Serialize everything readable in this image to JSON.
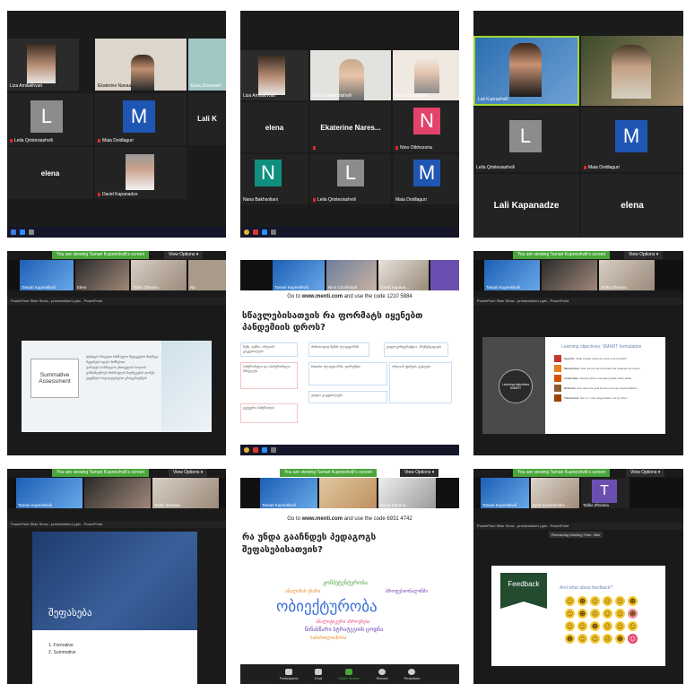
{
  "colors": {
    "blue_avatar": "#1f56b4",
    "teal_avatar": "#0f8f7e",
    "pink_avatar": "#e3426a",
    "grey_avatar": "#8c8c8c",
    "banner_green": "#4aa53a"
  },
  "screens": {
    "s1": {
      "tiles": [
        {
          "name": "Liza Amilakhvari"
        },
        {
          "name": "Ekaterine Nanaa..."
        },
        {
          "name": "Eliza Zhvaniani"
        },
        {
          "name": "Leila Qristesiashvili",
          "avatar": "L"
        },
        {
          "name": "Maia Doidlaguri",
          "avatar": "M"
        },
        {
          "name": "Lali K"
        },
        {
          "name": "elena"
        },
        {
          "name": "David Kapanadze"
        }
      ]
    },
    "s2": {
      "tiles": [
        {
          "name": "Liza Amilakhvari"
        },
        {
          "name": "Bela Goderdzishvili"
        },
        {
          "name": "Nino Chorkhauli"
        },
        {
          "name": "elena"
        },
        {
          "name": "Ekaterine Nares..."
        },
        {
          "name": "Nino Otkhozoria",
          "avatar": "N"
        },
        {
          "name": "Nana Bakhsoliani",
          "avatar": "N"
        },
        {
          "name": "Leila Qristesiashvili",
          "avatar": "L"
        },
        {
          "name": "Maia Doidlaguri",
          "avatar": "M"
        }
      ]
    },
    "s3": {
      "tiles": [
        {
          "name": "Lali Kuprashvili"
        },
        {
          "name": ""
        },
        {
          "name": "Leila Qristesiashvili",
          "avatar": "L"
        },
        {
          "name": "Maia Doidlaguri",
          "avatar": "M"
        },
        {
          "name": "Lali Kapanadze"
        },
        {
          "name": "elena"
        }
      ]
    },
    "common": {
      "banner": "You are viewing Tamari Kupreishvili's screen",
      "view_options": "View Options ▾",
      "ppt_title": "PowerPoint Slide Show - presentation1.pptx - PowerPoint"
    },
    "s4": {
      "strip": [
        "Tamari Kupreishvili",
        "Eleni",
        "Taliko Zhvania",
        "Na"
      ],
      "slide_title": "Summative Assessment",
      "bullets": [
        "ფასდება ზოგადი სასწავლო შედეგების მიღწევა",
        "შეფასება ხდება ნიშნებით",
        "ტარდება სასწავლო ერთეულის ბოლოს",
        "განსაზღვრავს მოსწავლის მიღწევების დონეს",
        "ეფუძნება სავალდებულო კრიტერიუმებს"
      ]
    },
    "s5": {
      "strip": [
        "Tamari Kupreishvili",
        "Nino Chorkhauli",
        "David Kapana..."
      ],
      "menti_prefix": "Go to ",
      "menti_site": "www.menti.com",
      "menti_suffix": " and use the code 1210 5884",
      "question": "სწავლებისათვის რა ფორმატს იყენებთ პანდემიის დროს?",
      "cards": [
        "ზუმი, ტიმსი, ონლაინ გაკვეთილები",
        "ძირითადად ზუმის პლატფორმა",
        "ვიდეოკონფერენცია, პრეზენტაციები",
        "სინქრონული და ასინქრონული სწავლება",
        "Moodle პლატფორმა, ფორუმები",
        "ონლაინ ქვიზები, ტესტები",
        "ჯგუფური სამუშაოები",
        "ვიდეო გაკვეთილები"
      ]
    },
    "s6": {
      "strip": [
        "Tamari Kupreishvili",
        "",
        "Taliko Zhvania"
      ],
      "center_circle": "Learning objectives SMART",
      "heading": "Learning objectives: SMART formulation",
      "items": [
        {
          "label": "Specific",
          "color": "#c0392b",
          "text": "State exactly what you want to accomplish"
        },
        {
          "label": "Measurable",
          "color": "#e67e22",
          "text": "How will you demonstrate and evaluate the extent"
        },
        {
          "label": "Achievable",
          "color": "#d35400",
          "text": "Identify action-orientated goals within ability"
        },
        {
          "label": "Relevant",
          "color": "#8e5b2e",
          "text": "How does the goal tie into your key responsibilities"
        },
        {
          "label": "Timebound",
          "color": "#a04000",
          "text": "Set 1 or more target dates, the by when"
        }
      ]
    },
    "s7": {
      "strip": [
        "Tamari Kupreishvili",
        "",
        "Taliko Zhvania"
      ],
      "title": "შეფასება",
      "items": [
        "1. Formative",
        "2. Summative"
      ]
    },
    "s8": {
      "strip": [
        "Tamari Kupreishvili",
        "",
        "David Kapana..."
      ],
      "menti_prefix": "Go to ",
      "menti_site": "www.menti.com",
      "menti_suffix": " and use the code 6931 4742",
      "question": "რა უნდა გააჩნდეს პედაგოგს შეფასებისათვის?",
      "words": [
        "კომპეტენტურობა",
        "ანალიზის უნარი",
        "პროფესიონალიზმი",
        "ობიექტურობა",
        "ანალიტიკური აზროვნება",
        "წინასწარი სტრატეგიის ცოდნა",
        "სამართლიანობა"
      ],
      "toolbar": [
        "Participants",
        "Chat",
        "Share Screen",
        "Record",
        "Reactions"
      ]
    },
    "s9": {
      "strip": [
        "Tamari Kupreishvili",
        "Beta Goderdzishv...",
        "Taliko Zhvania"
      ],
      "strip_avatar": "T",
      "timer": "Remaining Meeting Time: 36m",
      "feedback_label": "Feedback",
      "question": "And what about feedback?",
      "emojis": [
        "☺",
        "☻",
        "☺",
        "☹",
        "☺",
        "☻",
        "☺",
        "☻",
        "☹",
        "☺",
        "☺",
        "☻",
        "☺",
        "☺",
        "☻",
        "☹",
        "☺",
        "☺",
        "☻",
        "☺",
        "☺",
        "☹",
        "☻",
        "☺"
      ]
    }
  }
}
